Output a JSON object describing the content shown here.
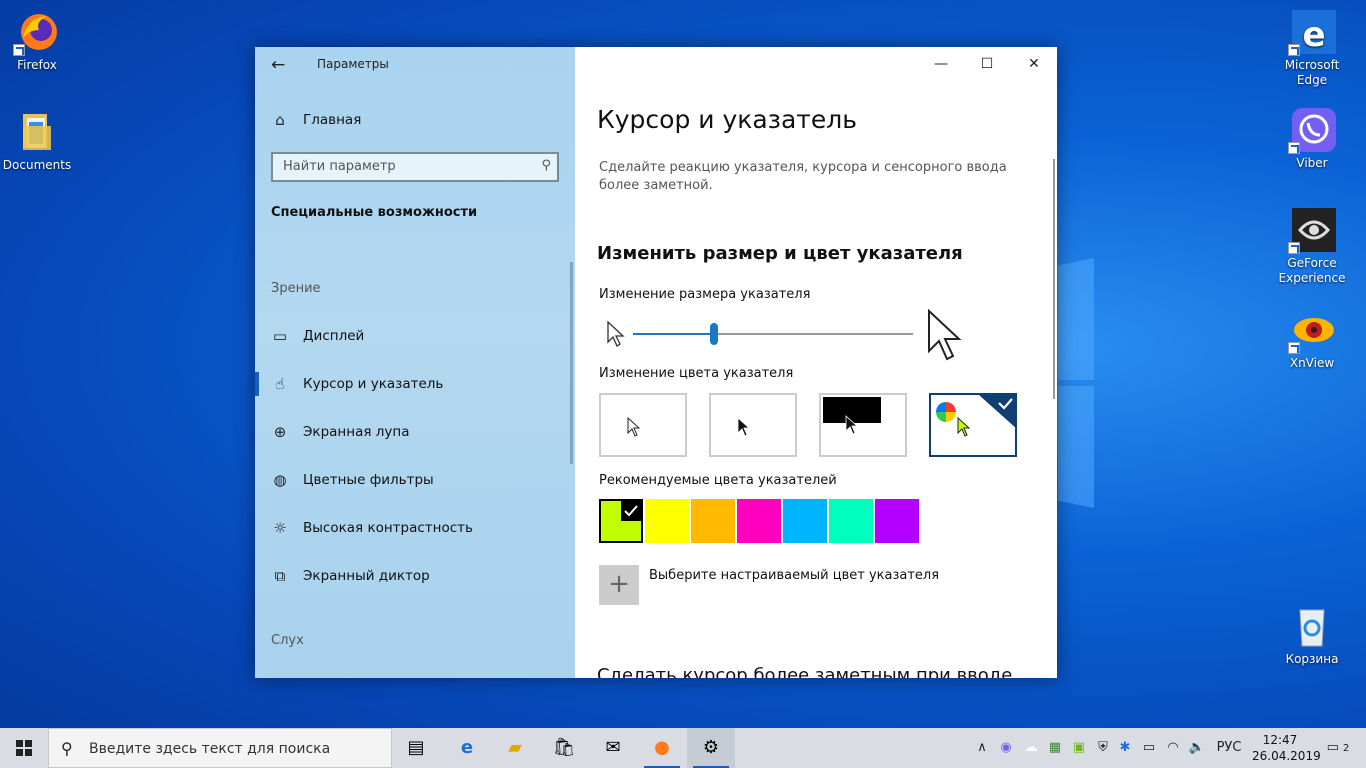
{
  "desktop": {
    "icons": [
      {
        "label": "Firefox"
      },
      {
        "label": "Documents"
      },
      {
        "label": "Microsoft Edge"
      },
      {
        "label": "Viber"
      },
      {
        "label": "GeForce Experience"
      },
      {
        "label": "XnView"
      },
      {
        "label": "Корзина"
      }
    ]
  },
  "window": {
    "app_title": "Параметры",
    "controls": {
      "minimize": "—",
      "maximize": "☐",
      "close": "✕"
    },
    "sidebar": {
      "home": "Главная",
      "search_placeholder": "Найти параметр",
      "section": "Специальные возможности",
      "group_vision": "Зрение",
      "group_hearing": "Слух",
      "items": [
        {
          "label": "Дисплей"
        },
        {
          "label": "Курсор и указатель",
          "selected": true
        },
        {
          "label": "Экранная лупа"
        },
        {
          "label": "Цветные фильтры"
        },
        {
          "label": "Высокая контрастность"
        },
        {
          "label": "Экранный диктор"
        }
      ]
    },
    "content": {
      "title": "Курсор и указатель",
      "description": "Сделайте реакцию указателя, курсора и сенсорного ввода более заметной.",
      "size_color_heading": "Изменить размер и цвет указателя",
      "size_label": "Изменение размера указателя",
      "size_value": 0.29,
      "color_label": "Изменение цвета указателя",
      "recommended_label": "Рекомендуемые цвета указателей",
      "swatches": [
        "#bfff00",
        "#ffff00",
        "#ffb900",
        "#ff00bf",
        "#00b4ff",
        "#00ffbf",
        "#b400ff"
      ],
      "selected_swatch": "#bfff00",
      "custom_color_label": "Выберите настраиваемый цвет указателя",
      "next_heading": "Сделать курсор более заметным при вводе"
    }
  },
  "taskbar": {
    "search_placeholder": "Введите здесь текст для поиска",
    "language": "РУС",
    "time": "12:47",
    "date": "26.04.2019",
    "notifications_count": "2"
  }
}
